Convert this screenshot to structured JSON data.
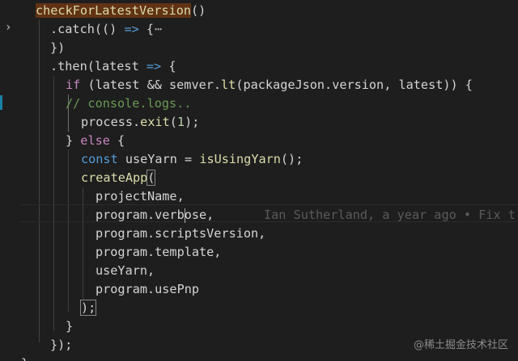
{
  "editor": {
    "gutter": {
      "fold_icon": "chevron-right-icon",
      "fold_glyph": "›"
    },
    "lines": [
      {
        "fn": "checkForLatestVersion",
        "rest": "()"
      },
      {
        "pre": ".catch(() ",
        "arrow": "=>",
        "post": " {",
        "dots": "⋯"
      },
      {
        "text": "})"
      },
      {
        "pre": ".then(latest ",
        "arrow": "=>",
        "post": " {"
      },
      {
        "kw": "if",
        "pre": " (latest && semver.",
        "fn": "lt",
        "mid": "(packageJson.version, latest)) {"
      },
      {
        "comment": "// console.logs.."
      },
      {
        "obj": "process",
        "dot": ".",
        "fn": "exit",
        "open": "(",
        "num": "1",
        "close": ");"
      },
      {
        "open": "} ",
        "kw": "else",
        "close": " {"
      },
      {
        "kw": "const",
        "var": " useYarn",
        "eq": " = ",
        "fn": "isUsingYarn",
        "close": "();"
      },
      {
        "fn": "createApp",
        "open": "("
      },
      {
        "text": "projectName,"
      },
      {
        "pre": "program.verb",
        "post": "ose,",
        "blame": "Ian Sutherland, a year ago • Fix t"
      },
      {
        "text": "program.scriptsVersion,"
      },
      {
        "text": "program.template,"
      },
      {
        "text": "useYarn,"
      },
      {
        "text": "program.usePnp"
      },
      {
        "text": ");"
      },
      {
        "text": "}"
      },
      {
        "text": "});"
      },
      {
        "text": "}"
      }
    ]
  },
  "watermark": "@稀土掘金技术社区"
}
